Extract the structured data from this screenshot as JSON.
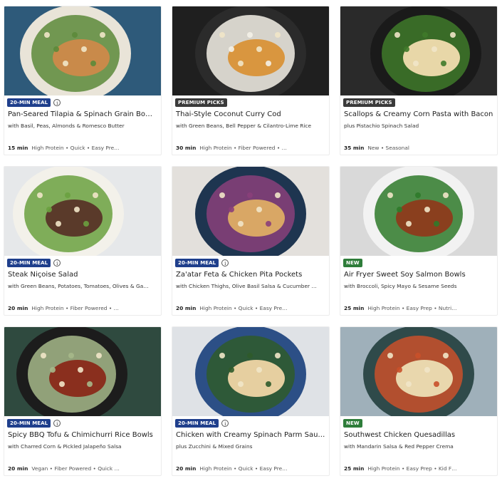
{
  "cards": [
    {
      "badge": "20-MIN MEAL",
      "badge_type": "min",
      "info": true,
      "title": "Pan-Seared Tilapia & Spinach Grain Bo…",
      "subtitle": "with Basil, Peas, Almonds & Romesco Butter",
      "time": "15 min",
      "tags": "High Protein • Quick • Easy Pre…",
      "photo": {
        "bg": "#2e5a7a",
        "plate": "#e9e4d8",
        "main": "#c98a4a",
        "accent": "#5c8a3a"
      }
    },
    {
      "badge": "PREMIUM PICKS",
      "badge_type": "premium",
      "info": false,
      "title": "Thai-Style Coconut Curry Cod",
      "subtitle": "with Green Beans, Bell Pepper & Cilantro-Lime Rice",
      "time": "30 min",
      "tags": "High Protein • Fiber Powered • …",
      "photo": {
        "bg": "#1f1f1f",
        "plate": "#2b2b2b",
        "main": "#d9963f",
        "accent": "#f4f1e8"
      }
    },
    {
      "badge": "PREMIUM PICKS",
      "badge_type": "premium",
      "info": false,
      "title": "Scallops & Creamy Corn Pasta with Bacon",
      "subtitle": "plus Pistachio Spinach Salad",
      "time": "35 min",
      "tags": "New • Seasonal",
      "photo": {
        "bg": "#2a2a2a",
        "plate": "#1a1a1a",
        "main": "#e8d7a8",
        "accent": "#3f7a2a"
      }
    },
    {
      "badge": "20-MIN MEAL",
      "badge_type": "min",
      "info": true,
      "title": "Steak Niçoise Salad",
      "subtitle": "with Green Beans, Potatoes, Tomatoes, Olives & Ga…",
      "time": "20 min",
      "tags": "High Protein • Fiber Powered • …",
      "photo": {
        "bg": "#e6e8ea",
        "plate": "#f3f1ea",
        "main": "#5a3a2a",
        "accent": "#6aa13f"
      }
    },
    {
      "badge": "20-MIN MEAL",
      "badge_type": "min",
      "info": true,
      "title": "Za'atar Feta & Chicken Pita Pockets",
      "subtitle": "with Chicken Thighs, Olive Basil Salsa & Cucumber …",
      "time": "20 min",
      "tags": "High Protein • Quick • Easy Pre…",
      "photo": {
        "bg": "#e3e0dc",
        "plate": "#1e3550",
        "main": "#d9a765",
        "accent": "#8a3f7a"
      }
    },
    {
      "badge": "NEW",
      "badge_type": "new",
      "info": false,
      "title": "Air Fryer Sweet Soy Salmon Bowls",
      "subtitle": "with Broccoli, Spicy Mayo & Sesame Seeds",
      "time": "25 min",
      "tags": "High Protein • Easy Prep • Nutri…",
      "photo": {
        "bg": "#d9d9d9",
        "plate": "#f2f2f2",
        "main": "#8a3f1e",
        "accent": "#2f7a2a"
      }
    },
    {
      "badge": "20-MIN MEAL",
      "badge_type": "min",
      "info": true,
      "title": "Spicy BBQ Tofu & Chimichurri Rice Bowls",
      "subtitle": "with Charred Corn & Pickled Jalapeño Salsa",
      "time": "20 min",
      "tags": "Vegan • Fiber Powered • Quick …",
      "photo": {
        "bg": "#2f4a3f",
        "plate": "#1c1c1c",
        "main": "#8a2f1e",
        "accent": "#a6b88a"
      }
    },
    {
      "badge": "20-MIN MEAL",
      "badge_type": "min",
      "info": true,
      "title": "Chicken with Creamy Spinach Parm Sau…",
      "subtitle": "plus Zucchini & Mixed Grains",
      "time": "20 min",
      "tags": "High Protein • Quick • Easy Pre…",
      "photo": {
        "bg": "#dfe2e6",
        "plate": "#2c4f86",
        "main": "#e6cfa0",
        "accent": "#2f5a2a"
      }
    },
    {
      "badge": "NEW",
      "badge_type": "new",
      "info": false,
      "title": "Southwest Chicken Quesadillas",
      "subtitle": "with Mandarin Salsa & Red Pepper Crema",
      "time": "25 min",
      "tags": "High Protein • Easy Prep • Kid F…",
      "photo": {
        "bg": "#9fb0ba",
        "plate": "#2f4a4a",
        "main": "#e9d7ad",
        "accent": "#c9502a"
      }
    }
  ],
  "info_icon_glyph": "i"
}
